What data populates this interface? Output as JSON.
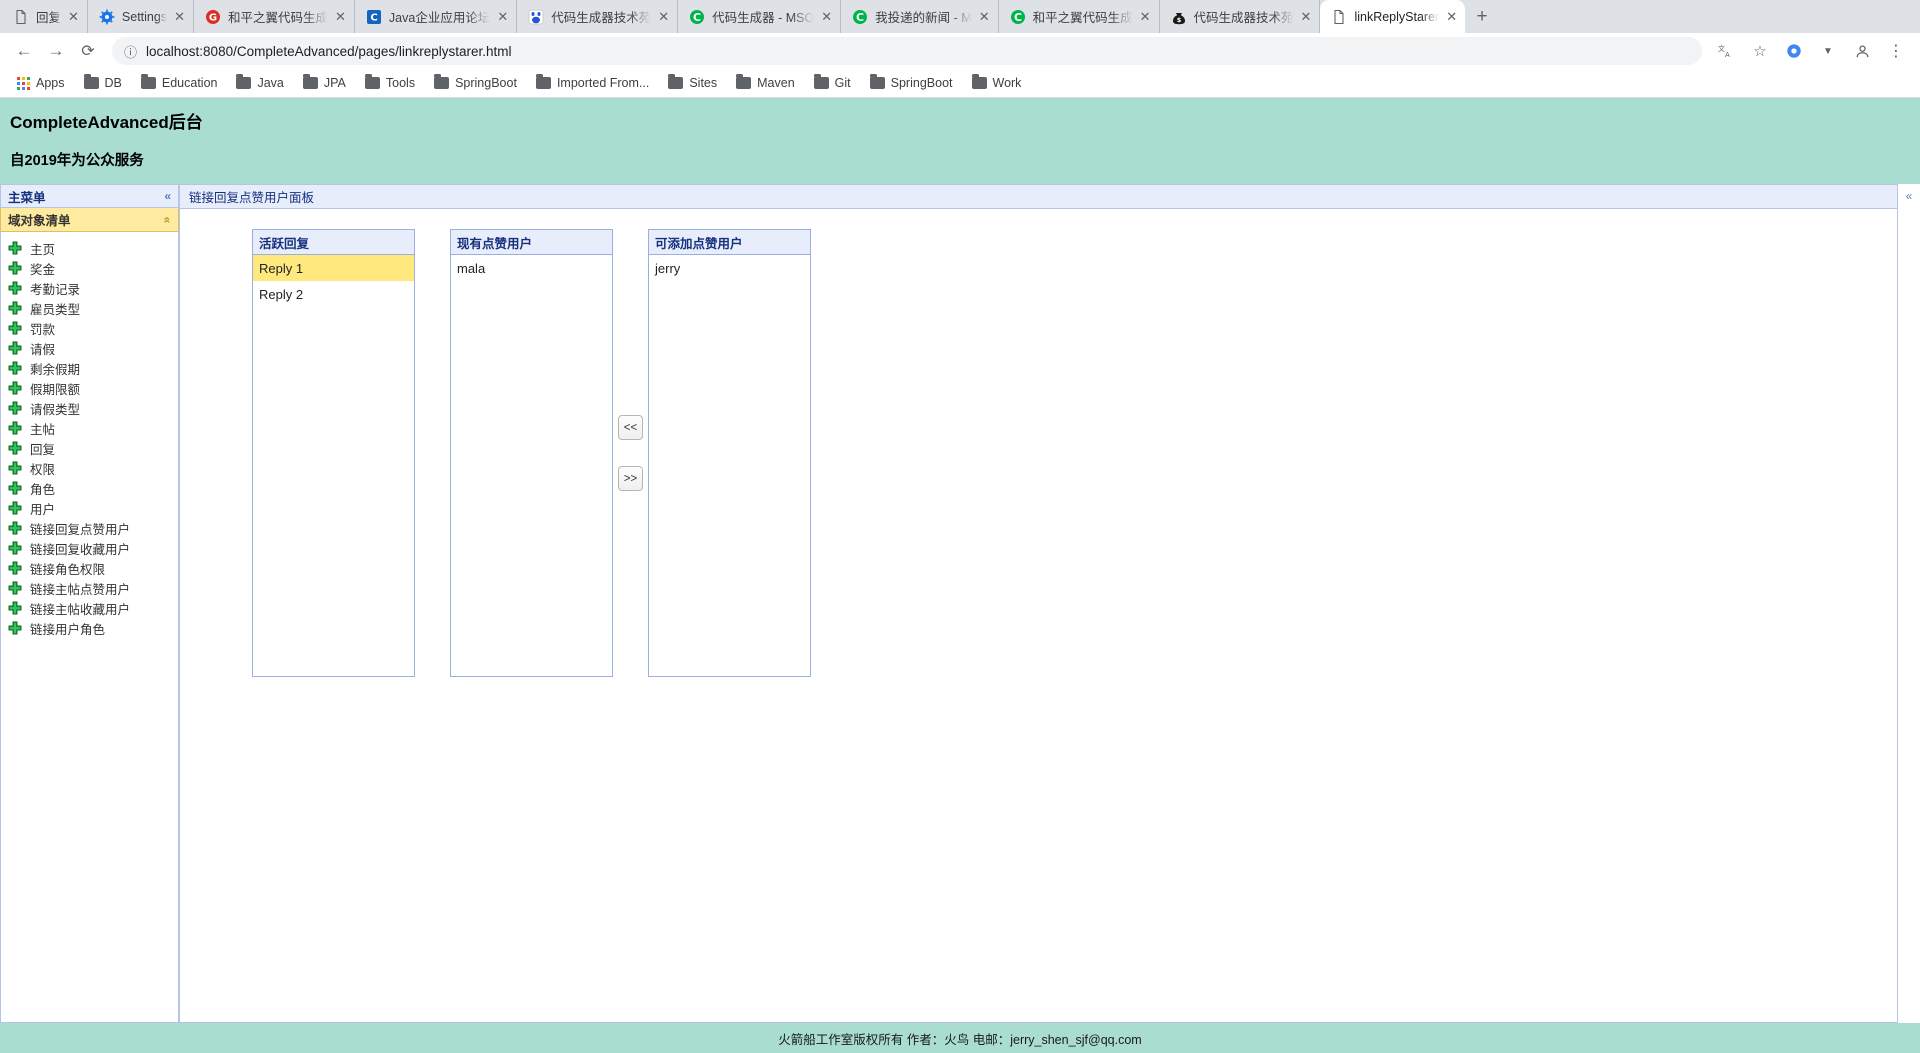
{
  "browser": {
    "tabs": [
      {
        "label": "回复",
        "icon": "page-icon",
        "active": false
      },
      {
        "label": "Settings",
        "icon": "gear-icon",
        "active": false
      },
      {
        "label": "和平之翼代码生成",
        "icon": "g-red-icon",
        "active": false
      },
      {
        "label": "Java企业应用论坛",
        "icon": "csdn-blue-icon",
        "active": false
      },
      {
        "label": "代码生成器技术苑",
        "icon": "baidu-icon",
        "active": false
      },
      {
        "label": "代码生成器 - MSO",
        "icon": "c-green-icon",
        "active": false
      },
      {
        "label": "我投递的新闻 - M",
        "icon": "c-green-icon",
        "active": false
      },
      {
        "label": "和平之翼代码生成",
        "icon": "c-green-icon",
        "active": false
      },
      {
        "label": "代码生成器技术苑",
        "icon": "moneybag-icon",
        "active": false
      },
      {
        "label": "linkReplyStarer",
        "icon": "page-icon",
        "active": true
      }
    ],
    "tab_close_label": "✕",
    "new_tab_label": "+",
    "nav": {
      "back": "←",
      "forward": "→",
      "reload": "⟳",
      "site_info": "ⓘ",
      "url": "localhost:8080/CompleteAdvanced/pages/linkreplystarer.html",
      "translate": "translate-icon",
      "bookmark_star": "☆",
      "extension": "extension-icon",
      "split_arrow": "▼",
      "profile": "profile-icon",
      "menu": "⋮"
    },
    "bookmarks": [
      {
        "label": "Apps",
        "icon": "apps-grid-icon"
      },
      {
        "label": "DB",
        "icon": "folder-icon"
      },
      {
        "label": "Education",
        "icon": "folder-icon"
      },
      {
        "label": "Java",
        "icon": "folder-icon"
      },
      {
        "label": "JPA",
        "icon": "folder-icon"
      },
      {
        "label": "Tools",
        "icon": "folder-icon"
      },
      {
        "label": "SpringBoot",
        "icon": "folder-icon"
      },
      {
        "label": "Imported From...",
        "icon": "folder-icon"
      },
      {
        "label": "Sites",
        "icon": "folder-icon"
      },
      {
        "label": "Maven",
        "icon": "folder-icon"
      },
      {
        "label": "Git",
        "icon": "folder-icon"
      },
      {
        "label": "SpringBoot",
        "icon": "folder-icon"
      },
      {
        "label": "Work",
        "icon": "folder-icon"
      }
    ]
  },
  "app": {
    "title": "CompleteAdvanced后台",
    "subtitle": "自2019年为公众服务",
    "header_bg": "#a8ddd0"
  },
  "sidebar": {
    "menu_title": "主菜单",
    "collapse_icon": "«",
    "section_title": "域对象清单",
    "section_collapse_icon": "«",
    "items": [
      {
        "label": "主页"
      },
      {
        "label": "奖金"
      },
      {
        "label": "考勤记录"
      },
      {
        "label": "雇员类型"
      },
      {
        "label": "罚款"
      },
      {
        "label": "请假"
      },
      {
        "label": "剩余假期"
      },
      {
        "label": "假期限额"
      },
      {
        "label": "请假类型"
      },
      {
        "label": "主帖"
      },
      {
        "label": "回复"
      },
      {
        "label": "权限"
      },
      {
        "label": "角色"
      },
      {
        "label": "用户"
      },
      {
        "label": "链接回复点赞用户"
      },
      {
        "label": "链接回复收藏用户"
      },
      {
        "label": "链接角色权限"
      },
      {
        "label": "链接主帖点赞用户"
      },
      {
        "label": "链接主帖收藏用户"
      },
      {
        "label": "链接用户角色"
      }
    ]
  },
  "panel": {
    "title": "链接回复点赞用户面板",
    "right_collapse_icon": "«",
    "columns": [
      {
        "header": "活跃回复",
        "items": [
          {
            "label": "Reply 1",
            "selected": true
          },
          {
            "label": "Reply 2",
            "selected": false
          }
        ]
      },
      {
        "header": "现有点赞用户",
        "items": [
          {
            "label": "mala",
            "selected": false
          }
        ]
      },
      {
        "header": "可添加点赞用户",
        "items": [
          {
            "label": "jerry",
            "selected": false
          }
        ]
      }
    ],
    "buttons": {
      "move_left": "<<",
      "move_right": ">>"
    },
    "selected_row_color": "#ffe97f"
  },
  "footer": {
    "text": "火箭船工作室版权所有 作者：火鸟 电邮：jerry_shen_sjf@qq.com"
  }
}
